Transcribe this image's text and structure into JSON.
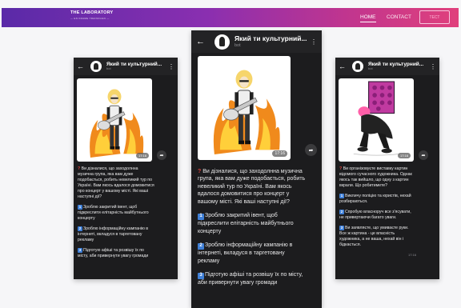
{
  "nav": {
    "logo_title": "THE LABORATORY",
    "logo_subtitle": "— EN KRAME TRAINIIGGN —",
    "home": "HOME",
    "contact": "CONTACT",
    "cta": "ТЕСТ"
  },
  "phones": {
    "left": {
      "title": "Який ти культурний...",
      "subtitle": "bot",
      "time": "17:16",
      "question": "Ви дізналися, що заходолнна музична група, яка вам дуже подобається, робить невеликий тур по Україні. Вам якось вдалося домовитися про концерт у вашому місті. Які ваші наступні дії?",
      "options": [
        {
          "num": "1",
          "text": "Зроблю закритий івент, щоб підкреслити елітарність майбутнього концерту"
        },
        {
          "num": "2",
          "text": "Зроблю інформаційну кампанію в інтернеті, вкладуся в таргетовану рекламу"
        },
        {
          "num": "3",
          "text": "Підготую афіші та розвішу їх по місту, аби привернути увагу громади"
        }
      ]
    },
    "center": {
      "title": "Який ти культурний...",
      "subtitle": "bot",
      "time": "17:16",
      "question": "Ви дізналися, що заходолнна музична група, яка вам дуже подобається, робить невеликий тур по Україні. Вам якось вдалося домовитися про концерт у вашому місті. Які ваші наступні дії?",
      "options": [
        {
          "num": "1",
          "text": "Зроблю закритий івент, щоб підкреслити елітарність майбутнього концерту"
        },
        {
          "num": "2",
          "text": "Зроблю інформаційну кампанію в інтернеті, вкладуся в таргетовану рекламу"
        },
        {
          "num": "3",
          "text": "Підготую афіші та розвішу їх по місту, аби привернути увагу громади"
        }
      ]
    },
    "right": {
      "title": "Який ти культурний...",
      "subtitle": "bot",
      "time": "17:16",
      "question": "Ви організовуєте виставку картин відомого сучасного художника. Однак якось так вийшло, що одну з картин вкрали. Що робитимете?",
      "options": [
        {
          "num": "1",
          "text": "Викличу поліцію та юристів, нехай розбираються."
        },
        {
          "num": "2",
          "text": "Спробую власноруч все з'ясувати, не привертаючи багато уваги."
        },
        {
          "num": "3",
          "text": "Ви заявляєте, що умиваєте руки. Все ж картина - це власність художника, а не ваша, нехай він і бідкається."
        }
      ],
      "footer_time": "17:16"
    }
  },
  "colors": {
    "nav_gradient_start": "#5a2aa8",
    "nav_gradient_end": "#e0407c",
    "phone_bg": "#1c1c1e",
    "option_badge": "#3f7fd6",
    "question_mark": "#e0443c"
  },
  "icons": {
    "back": "arrow-left",
    "menu": "vertical-ellipsis",
    "share": "arrow-right-share",
    "question": "red-question-mark"
  }
}
